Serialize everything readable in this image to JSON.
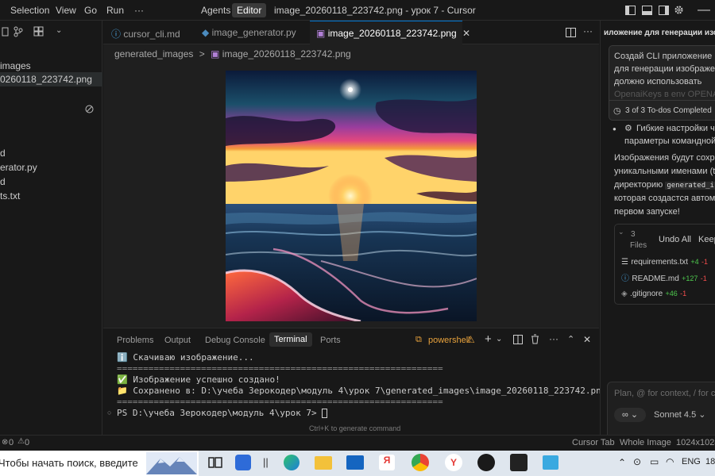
{
  "titlebar": {
    "menu": [
      "Selection",
      "View",
      "Go",
      "Run",
      "···"
    ],
    "agents_label": "Agents",
    "editor_label": "Editor",
    "window_title": "image_20260118_223742.png - урок 7 - Cursor"
  },
  "sidebar": {
    "items": [
      "images",
      "0260118_223742.png",
      "d",
      "erator.py",
      "d",
      "ts.txt"
    ]
  },
  "tabs": [
    {
      "label": "cursor_cli.md",
      "icon": "info-icon",
      "active": false
    },
    {
      "label": "image_generator.py",
      "icon": "python-icon",
      "active": false
    },
    {
      "label": "image_20260118_223742.png",
      "icon": "image-icon",
      "active": true
    }
  ],
  "breadcrumb": {
    "folder": "generated_images",
    "sep": ">",
    "file": "image_20260118_223742.png"
  },
  "panel": {
    "tabs": [
      "Problems",
      "Output",
      "Debug Console",
      "Terminal",
      "Ports"
    ],
    "active_tab": "Terminal",
    "shell_label": "powershell",
    "terminal_lines": [
      "ℹ️ Скачиваю изображение...",
      "==============================================================",
      "✅ Изображение успешно создано!",
      "📁 Сохранено в: D:\\учеба Зерокодер\\модуль 4\\урок 7\\generated_images\\image_20260118_223742.png",
      "==============================================================",
      "PS D:\\учеба Зерокодер\\модуль 4\\урок 7> "
    ],
    "hint": "Ctrl+K to generate command"
  },
  "chat": {
    "title": "иложение для генерации изоб",
    "user_message": [
      "Создай CLI приложение на",
      "для генерации изображени",
      "должно использовать",
      "OpenaiKeys в env OPENAI"
    ],
    "todos": "3 of 3 To-dos Completed",
    "bullet": [
      "Гибкие настройки ч",
      "параметры командной"
    ],
    "paragraph": [
      "Изображения будут сохра",
      "уникальными именами (ti",
      "директорию",
      "которая создастся автома",
      "первом запуске!"
    ],
    "code_inline": "generated_i",
    "files_count": "3",
    "files_word": "Files",
    "undo_all": "Undo All",
    "keep": "Keep",
    "files": [
      {
        "name": "requirements.txt",
        "added": "+4",
        "removed": "-1",
        "icon": "list-icon"
      },
      {
        "name": "README.md",
        "added": "+127",
        "removed": "-1",
        "icon": "info-icon"
      },
      {
        "name": ".gitignore",
        "added": "+46",
        "removed": "-1",
        "icon": "diamond-icon"
      }
    ],
    "input_placeholder": "Plan, @ for context, / for co",
    "mode_label": "∞",
    "model_label": "Sonnet 4.5"
  },
  "statusbar": {
    "errors": "0",
    "warnings": "0",
    "cursor_tab": "Cursor Tab",
    "whole_image": "Whole Image",
    "dimensions": "1024x1024"
  },
  "taskbar": {
    "search_placeholder": "Чтобы начать поиск, введите",
    "lang": "ENG",
    "time": "18"
  }
}
